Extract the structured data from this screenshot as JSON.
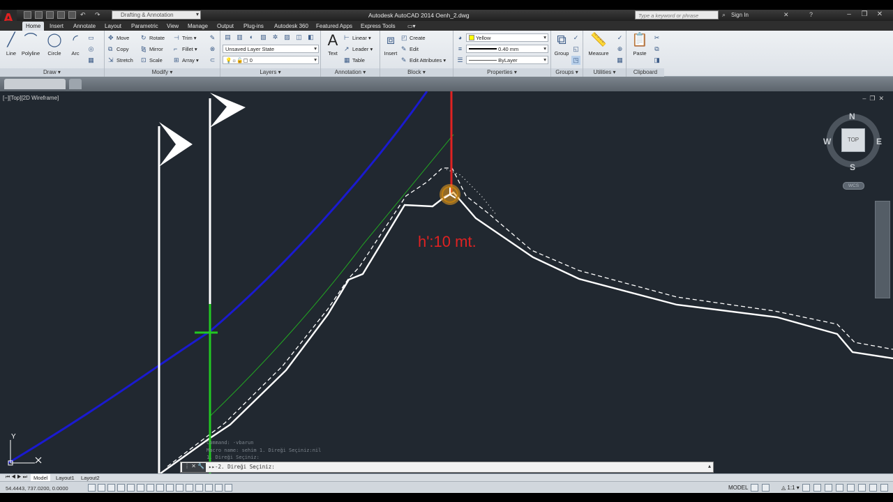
{
  "titlebar": {
    "workspace": "Drafting & Annotation",
    "title": "Autodesk AutoCAD 2014   Oenh_2.dwg",
    "search_placeholder": "Type a keyword or phrase",
    "signin": "Sign In"
  },
  "tabs": [
    "Home",
    "Insert",
    "Annotate",
    "Layout",
    "Parametric",
    "View",
    "Manage",
    "Output",
    "Plug-ins",
    "Autodesk 360",
    "Featured Apps",
    "Express Tools"
  ],
  "ribbon": {
    "draw": {
      "title": "Draw",
      "line": "Line",
      "polyline": "Polyline",
      "circle": "Circle",
      "arc": "Arc"
    },
    "modify": {
      "title": "Modify",
      "move": "Move",
      "rotate": "Rotate",
      "trim": "Trim",
      "copy": "Copy",
      "mirror": "Mirror",
      "fillet": "Fillet",
      "stretch": "Stretch",
      "scale": "Scale",
      "array": "Array"
    },
    "layers": {
      "title": "Layers",
      "layer_state": "Unsaved Layer State",
      "current_layer": "0"
    },
    "annotation": {
      "title": "Annotation",
      "text": "Text",
      "linear": "Linear",
      "leader": "Leader",
      "table": "Table"
    },
    "block": {
      "title": "Block",
      "insert": "Insert",
      "create": "Create",
      "edit": "Edit",
      "edit_attributes": "Edit Attributes"
    },
    "properties": {
      "title": "Properties",
      "color": "Yellow",
      "lineweight": "0.40 mm",
      "linetype": "ByLayer"
    },
    "groups": {
      "title": "Groups",
      "group": "Group"
    },
    "utilities": {
      "title": "Utilities",
      "measure": "Measure"
    },
    "clipboard": {
      "title": "Clipboard",
      "paste": "Paste"
    }
  },
  "viewport": {
    "label": "[−][Top][2D Wireframe]",
    "annotation": "h':10 mt.",
    "viewcube": {
      "n": "N",
      "s": "S",
      "e": "E",
      "w": "W",
      "top": "TOP",
      "wcs": "WCS"
    },
    "ucs_y": "Y"
  },
  "command": {
    "history": [
      "Command: -vbarun",
      "Macro name: sehim 1. Direği Seçiniz:nil",
      "1. Direği Seçiniz:"
    ],
    "prompt": "2. Direği Seçiniz:"
  },
  "layout_tabs": [
    "Model",
    "Layout1",
    "Layout2"
  ],
  "status": {
    "coords": "54.4443, 737.0200, 0.0000",
    "space": "MODEL",
    "scale": "1:1"
  },
  "colors": {
    "viewport_bg": "#212830",
    "annotation_red": "#e02222",
    "polyline_blue": "#1a1ad0",
    "guide_green": "#22c822"
  }
}
